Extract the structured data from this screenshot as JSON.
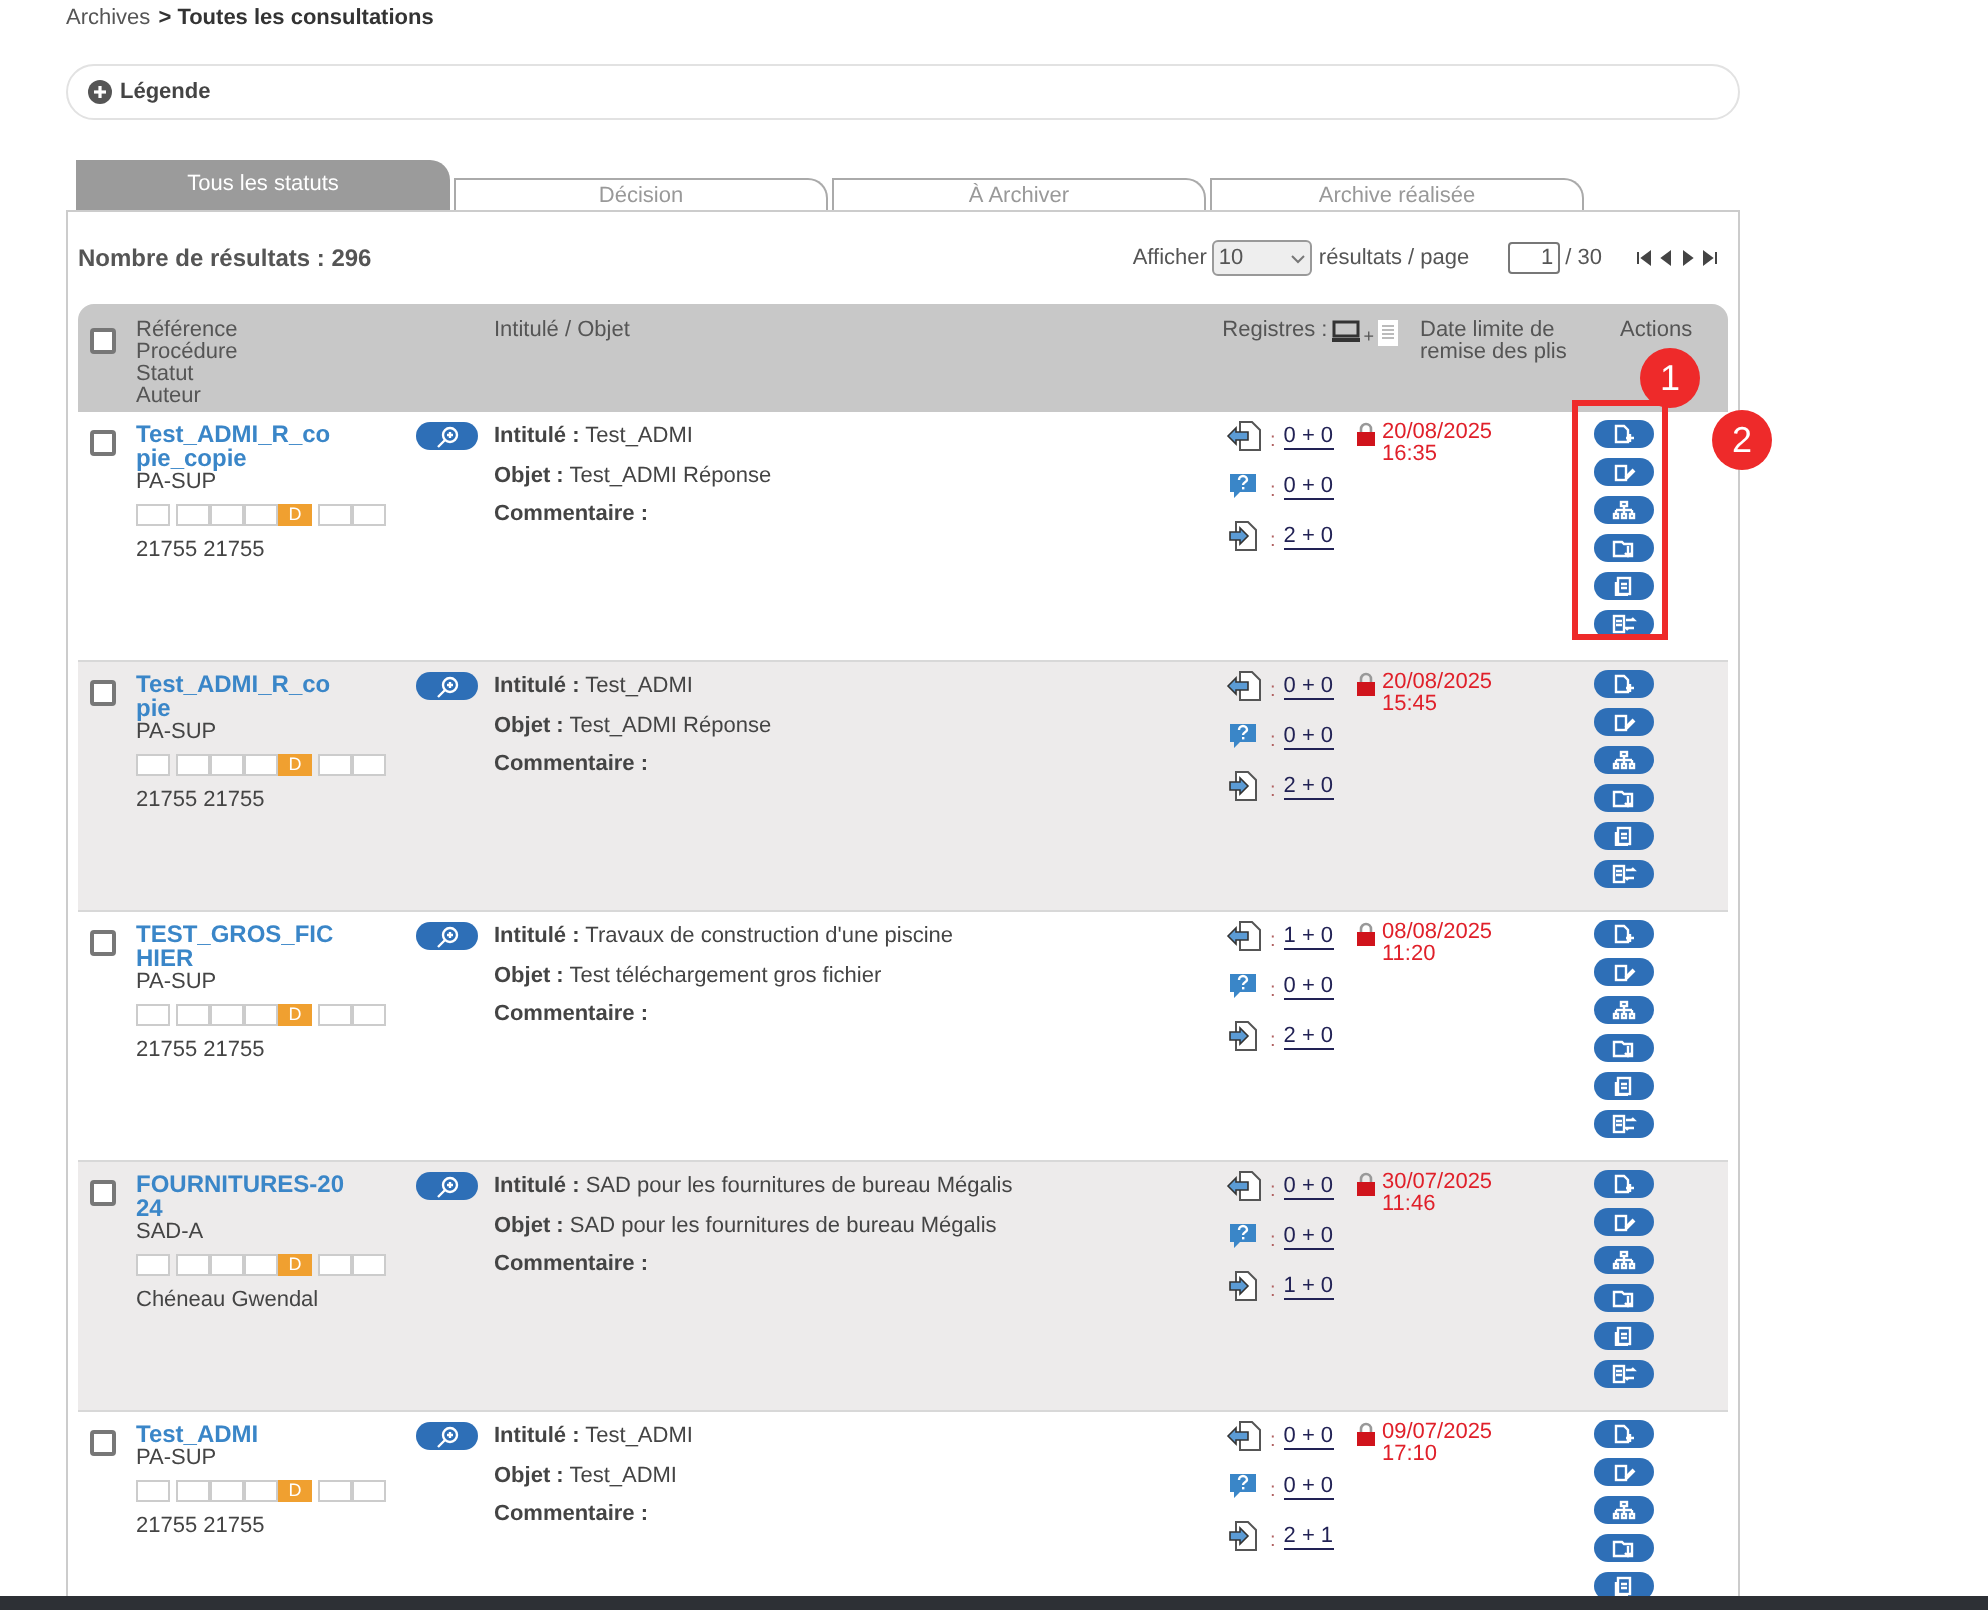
{
  "breadcrumb": {
    "parent": "Archives",
    "separator": ">",
    "current": "Toutes les consultations"
  },
  "legend": {
    "label": "Légende",
    "expanded": false
  },
  "tabs": [
    {
      "label": "Tous les statuts",
      "selected": true
    },
    {
      "label": "Décision",
      "selected": false
    },
    {
      "label": "À Archiver",
      "selected": false
    },
    {
      "label": "Archive réalisée",
      "selected": false
    }
  ],
  "results": {
    "label": "Nombre de résultats : 296",
    "show_label": "Afficher",
    "page_size": "10",
    "per_page_label": "résultats / page",
    "page": "1",
    "page_total": "/ 30"
  },
  "table": {
    "columns": {
      "select_all_checked": false,
      "reference": [
        "Référence",
        "Procédure",
        "Statut",
        "Auteur"
      ],
      "title": "Intitulé  / Objet",
      "registers": "Registres :",
      "registers_plus": "+",
      "deadline": "Date limite de remise des plis",
      "actions": "Actions"
    },
    "rows": [
      {
        "checked": false,
        "reference": "Test_ADMI_R_copie_copie",
        "procedure": "PA-SUP",
        "author": "21755 21755",
        "fields": [
          {
            "label": "Intitulé :",
            "value": "Test_ADMI"
          },
          {
            "label": "Objet :",
            "value": "Test_ADMI Réponse"
          },
          {
            "label": "Commentaire :"
          }
        ],
        "registers": [
          {
            "kind": "withdrawals",
            "sep": ":",
            "value": "0 + 0"
          },
          {
            "kind": "questions",
            "sep": ":",
            "value": "0 + 0"
          },
          {
            "kind": "deposits",
            "sep": ":",
            "value": "2 + 0"
          }
        ],
        "date": "20/08/2025",
        "time": "16:35",
        "highlighted": true,
        "steps": [
          {
            "active": false
          },
          {
            "active": false
          },
          {
            "active": false
          },
          {
            "active": false
          },
          {
            "active": true,
            "label": "D"
          },
          {
            "active": false
          },
          {
            "active": false
          }
        ],
        "actions": [
          {
            "kind": "add-document"
          },
          {
            "kind": "edit"
          },
          {
            "kind": "tree"
          },
          {
            "kind": "folder-download"
          },
          {
            "kind": "archive"
          },
          {
            "kind": "transfer"
          }
        ]
      },
      {
        "checked": false,
        "reference": "Test_ADMI_R_copie",
        "procedure": "PA-SUP",
        "author": "21755 21755",
        "fields": [
          {
            "label": "Intitulé :",
            "value": "Test_ADMI"
          },
          {
            "label": "Objet :",
            "value": "Test_ADMI Réponse"
          },
          {
            "label": "Commentaire :"
          }
        ],
        "registers": [
          {
            "kind": "withdrawals",
            "sep": ":",
            "value": "0 + 0"
          },
          {
            "kind": "questions",
            "sep": ":",
            "value": "0 + 0"
          },
          {
            "kind": "deposits",
            "sep": ":",
            "value": "2 + 0"
          }
        ],
        "date": "20/08/2025",
        "time": "15:45",
        "highlighted": false,
        "steps": [
          {
            "active": false
          },
          {
            "active": false
          },
          {
            "active": false
          },
          {
            "active": false
          },
          {
            "active": true,
            "label": "D"
          },
          {
            "active": false
          },
          {
            "active": false
          }
        ],
        "actions": [
          {
            "kind": "add-document"
          },
          {
            "kind": "edit"
          },
          {
            "kind": "tree"
          },
          {
            "kind": "folder-download"
          },
          {
            "kind": "archive"
          },
          {
            "kind": "transfer"
          }
        ]
      },
      {
        "checked": false,
        "reference": "TEST_GROS_FICHIER",
        "procedure": "PA-SUP",
        "author": "21755 21755",
        "fields": [
          {
            "label": "Intitulé :",
            "value": "Travaux de construction d'une piscine"
          },
          {
            "label": "Objet :",
            "value": "Test téléchargement gros fichier"
          },
          {
            "label": "Commentaire :"
          }
        ],
        "registers": [
          {
            "kind": "withdrawals",
            "sep": ":",
            "value": "1 + 0"
          },
          {
            "kind": "questions",
            "sep": ":",
            "value": "0 + 0"
          },
          {
            "kind": "deposits",
            "sep": ":",
            "value": "2 + 0"
          }
        ],
        "date": "08/08/2025",
        "time": "11:20",
        "highlighted": false,
        "steps": [
          {
            "active": false
          },
          {
            "active": false
          },
          {
            "active": false
          },
          {
            "active": false
          },
          {
            "active": true,
            "label": "D"
          },
          {
            "active": false
          },
          {
            "active": false
          }
        ],
        "actions": [
          {
            "kind": "add-document"
          },
          {
            "kind": "edit"
          },
          {
            "kind": "tree"
          },
          {
            "kind": "folder-download"
          },
          {
            "kind": "archive"
          },
          {
            "kind": "transfer"
          }
        ]
      },
      {
        "checked": false,
        "reference": "FOURNITURES-2024",
        "procedure": "SAD-A",
        "author": "Chéneau Gwendal",
        "fields": [
          {
            "label": "Intitulé :",
            "value": "SAD pour les fournitures de bureau Mégalis"
          },
          {
            "label": "Objet :",
            "value": "SAD pour les fournitures de bureau Mégalis"
          },
          {
            "label": "Commentaire :"
          }
        ],
        "registers": [
          {
            "kind": "withdrawals",
            "sep": ":",
            "value": "0 + 0"
          },
          {
            "kind": "questions",
            "sep": ":",
            "value": "0 + 0"
          },
          {
            "kind": "deposits",
            "sep": ":",
            "value": "1 + 0"
          }
        ],
        "date": "30/07/2025",
        "time": "11:46",
        "highlighted": false,
        "steps": [
          {
            "active": false
          },
          {
            "active": false
          },
          {
            "active": false
          },
          {
            "active": false
          },
          {
            "active": true,
            "label": "D"
          },
          {
            "active": false
          },
          {
            "active": false
          }
        ],
        "actions": [
          {
            "kind": "add-document"
          },
          {
            "kind": "edit"
          },
          {
            "kind": "tree"
          },
          {
            "kind": "folder-download"
          },
          {
            "kind": "archive"
          },
          {
            "kind": "transfer"
          }
        ]
      },
      {
        "checked": false,
        "reference": "Test_ADMI",
        "procedure": "PA-SUP",
        "author": "21755 21755",
        "fields": [
          {
            "label": "Intitulé :",
            "value": "Test_ADMI"
          },
          {
            "label": "Objet :",
            "value": "Test_ADMI"
          },
          {
            "label": "Commentaire :"
          }
        ],
        "registers": [
          {
            "kind": "withdrawals",
            "sep": ":",
            "value": "0 + 0"
          },
          {
            "kind": "questions",
            "sep": ":",
            "value": "0 + 0"
          },
          {
            "kind": "deposits",
            "sep": ":",
            "value": "2 + 1"
          }
        ],
        "date": "09/07/2025",
        "time": "17:10",
        "highlighted": false,
        "steps": [
          {
            "active": false
          },
          {
            "active": false
          },
          {
            "active": false
          },
          {
            "active": false
          },
          {
            "active": true,
            "label": "D"
          },
          {
            "active": false
          },
          {
            "active": false
          }
        ],
        "actions": [
          {
            "kind": "add-document"
          },
          {
            "kind": "edit"
          },
          {
            "kind": "tree"
          },
          {
            "kind": "folder-download"
          },
          {
            "kind": "archive"
          }
        ]
      }
    ]
  },
  "annotations": [
    {
      "label": "1"
    },
    {
      "label": "2"
    }
  ]
}
